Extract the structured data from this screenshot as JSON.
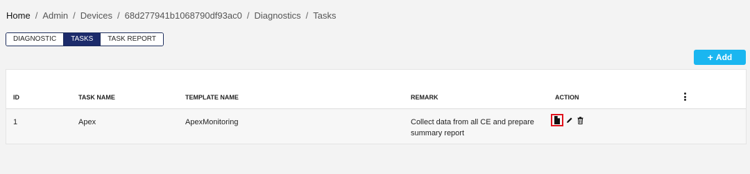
{
  "breadcrumb": {
    "items": [
      {
        "label": "Home"
      },
      {
        "label": "Admin"
      },
      {
        "label": "Devices"
      },
      {
        "label": "68d277941b1068790df93ac0"
      },
      {
        "label": "Diagnostics"
      },
      {
        "label": "Tasks"
      }
    ],
    "separator": "/"
  },
  "tabs": [
    {
      "label": "DIAGNOSTIC",
      "active": false
    },
    {
      "label": "TASKS",
      "active": true
    },
    {
      "label": "TASK REPORT",
      "active": false
    }
  ],
  "add_button": {
    "label": "Add",
    "icon": "plus-icon",
    "color": "#1ab6f0"
  },
  "table": {
    "columns": [
      "ID",
      "TASK NAME",
      "TEMPLATE NAME",
      "REMARK",
      "ACTION"
    ],
    "rows": [
      {
        "id": "1",
        "task_name": "Apex",
        "template_name": "ApexMonitoring",
        "remark": "Collect data from all CE and prepare summary report",
        "actions": [
          "document-icon",
          "pencil-icon",
          "trash-icon"
        ]
      }
    ],
    "menu_icon": "kebab-menu-icon"
  },
  "colors": {
    "active_tab": "#1c2b6b",
    "highlight_border": "#e0101a"
  }
}
